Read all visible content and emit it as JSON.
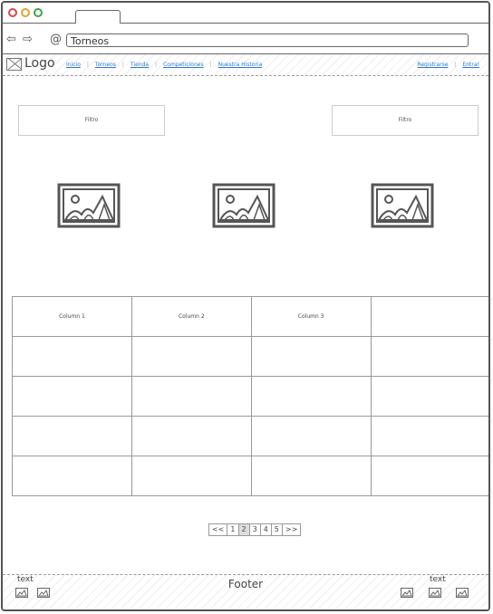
{
  "browser": {
    "url": "Torneos"
  },
  "nav": {
    "logo": "Logo",
    "items": [
      "Inicio",
      "Torneos",
      "Tienda",
      "Competiciones",
      "Nuestra Historia"
    ],
    "right_items": [
      "Registrarse",
      "Entrar"
    ]
  },
  "filters": [
    "Filtro",
    "Filtro"
  ],
  "table": {
    "headers": [
      "Column 1",
      "Column 2",
      "Column 3",
      ""
    ],
    "rows": [
      [
        "",
        "",
        "",
        ""
      ],
      [
        "",
        "",
        "",
        ""
      ],
      [
        "",
        "",
        "",
        ""
      ],
      [
        "",
        "",
        "",
        ""
      ]
    ]
  },
  "pager": [
    "<<",
    "1",
    "2",
    "3",
    "4",
    "5",
    ">>"
  ],
  "pager_current": "2",
  "footer": {
    "title": "Footer",
    "left_text": "text",
    "right_text": "text"
  }
}
